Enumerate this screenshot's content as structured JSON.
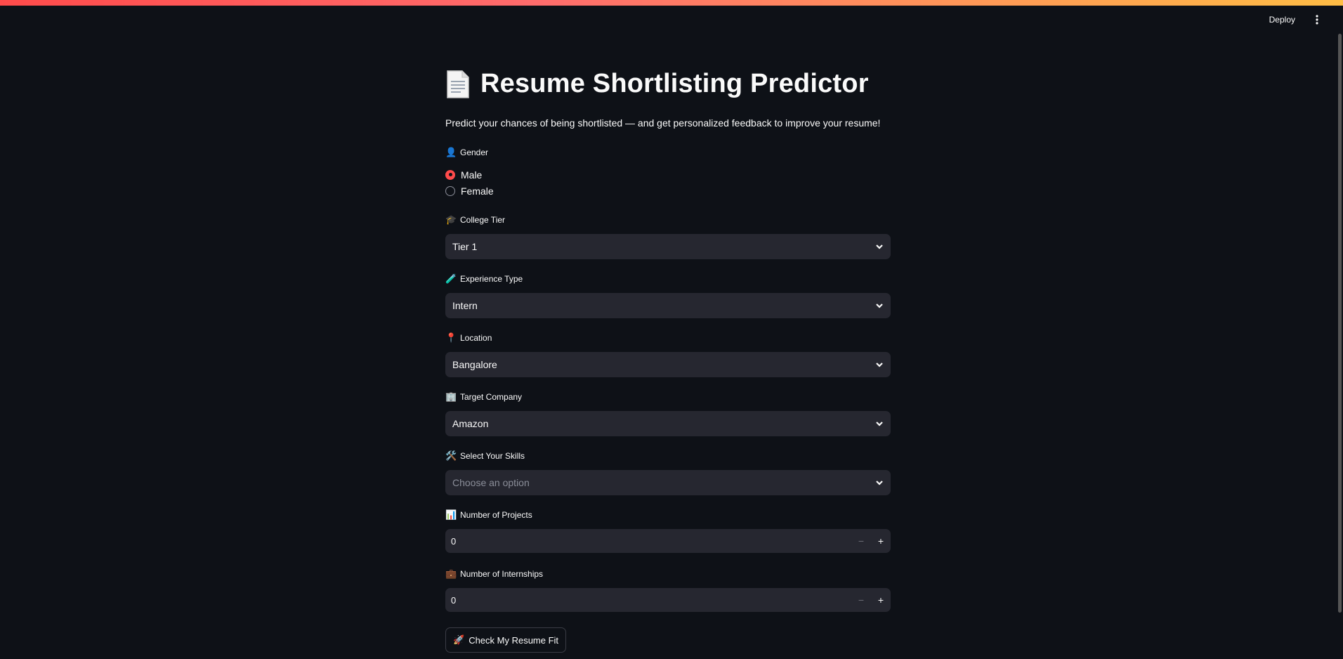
{
  "header": {
    "deploy_label": "Deploy",
    "menu_icon": "more-vertical-icon"
  },
  "app": {
    "title_icon": "📄",
    "title": "Resume Shortlisting Predictor",
    "subtitle": "Predict your chances of being shortlisted — and get personalized feedback to improve your resume!"
  },
  "gender": {
    "icon": "👤",
    "label": "Gender",
    "options": [
      "Male",
      "Female"
    ],
    "selected": "Male"
  },
  "college_tier": {
    "icon": "🎓",
    "label": "College Tier",
    "value": "Tier 1"
  },
  "experience_type": {
    "icon": "🧪",
    "label": "Experience Type",
    "value": "Intern"
  },
  "location": {
    "icon": "📍",
    "label": "Location",
    "value": "Bangalore"
  },
  "target_company": {
    "icon": "🏢",
    "label": "Target Company",
    "value": "Amazon"
  },
  "skills": {
    "icon": "🛠️",
    "label": "Select Your Skills",
    "placeholder": "Choose an option"
  },
  "projects": {
    "icon": "📊",
    "label": "Number of Projects",
    "value": "0"
  },
  "internships": {
    "icon": "💼",
    "label": "Number of Internships",
    "value": "0"
  },
  "stepper": {
    "minus": "−",
    "plus": "+"
  },
  "submit": {
    "icon": "🚀",
    "label": "Check My Resume Fit"
  },
  "colors": {
    "accent": "#ff4b4b",
    "background": "#0e1117",
    "input_bg": "#262730"
  }
}
